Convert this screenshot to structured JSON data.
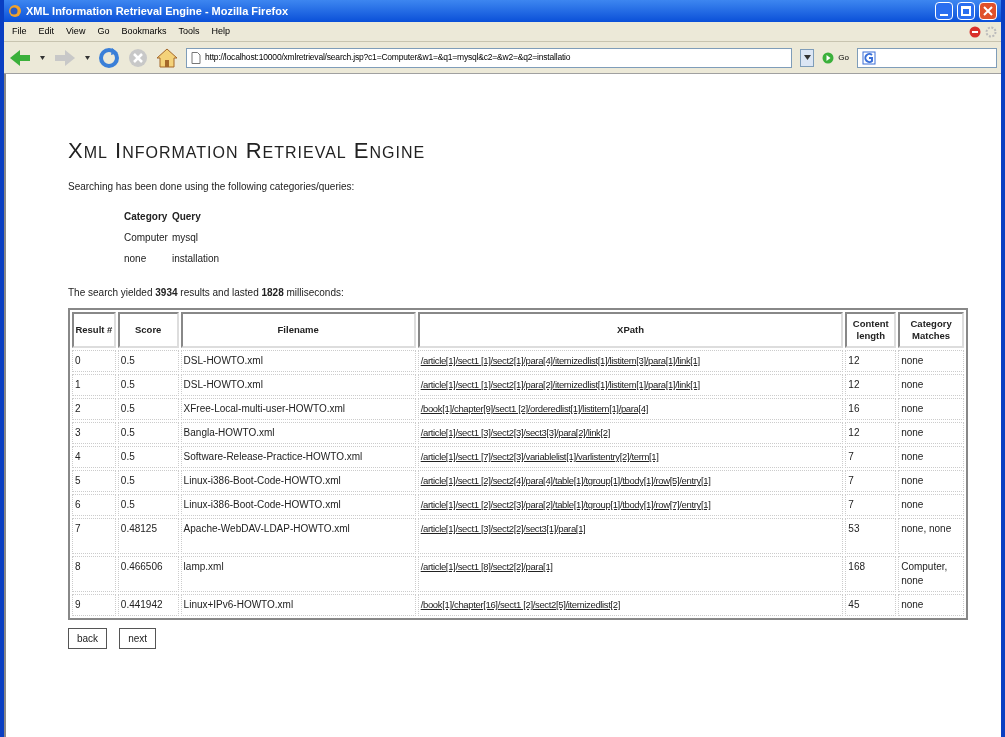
{
  "window": {
    "title": "XML Information Retrieval Engine - Mozilla Firefox"
  },
  "menu": [
    "File",
    "Edit",
    "View",
    "Go",
    "Bookmarks",
    "Tools",
    "Help"
  ],
  "address": {
    "value": "http://localhost:10000/xmlretrieval/search.jsp?c1=Computer&w1=&q1=mysql&c2=&w2=&q2=installatio"
  },
  "go_label": "Go",
  "page": {
    "heading": "XML INFORMATION RETRIEVAL ENGINE",
    "intro": "Searching has been done using the following categories/queries:",
    "queries": {
      "columns": [
        "Category",
        "Query"
      ],
      "rows": [
        [
          "Computer",
          "mysql"
        ],
        [
          "none",
          "installation"
        ]
      ]
    },
    "summary": "The search yielded **3934** results and lasted **1828** milliseconds:",
    "table": {
      "columns": [
        "Result #",
        "Score",
        "Filename",
        "XPath",
        "Content length",
        "Category Matches"
      ],
      "rows": [
        {
          "result": "0",
          "score": "0.5",
          "filename": "DSL-HOWTO.xml",
          "xpath": "/article[1]/sect1 [1]/sect2[1]/para[4]/itemizedlist[1]/listitem[3]/para[1]/link[1]",
          "length": "12",
          "matches": "none"
        },
        {
          "result": "1",
          "score": "0.5",
          "filename": "DSL-HOWTO.xml",
          "xpath": "/article[1]/sect1 [1]/sect2[1]/para[2]/itemizedlist[1]/listitem[1]/para[1]/link[1]",
          "length": "12",
          "matches": "none"
        },
        {
          "result": "2",
          "score": "0.5",
          "filename": "XFree-Local-multi-user-HOWTO.xml",
          "xpath": "/book[1]/chapter[9]/sect1 [2]/orderedlist[1]/listitem[1]/para[4]",
          "length": "16",
          "matches": "none"
        },
        {
          "result": "3",
          "score": "0.5",
          "filename": "Bangla-HOWTO.xml",
          "xpath": "/article[1]/sect1 [3]/sect2[3]/sect3[3]/para[2]/link[2]",
          "length": "12",
          "matches": "none"
        },
        {
          "result": "4",
          "score": "0.5",
          "filename": "Software-Release-Practice-HOWTO.xml",
          "xpath": "/article[1]/sect1 [7]/sect2[3]/variablelist[1]/varlistentry[2]/term[1]",
          "length": "7",
          "matches": "none"
        },
        {
          "result": "5",
          "score": "0.5",
          "filename": "Linux-i386-Boot-Code-HOWTO.xml",
          "xpath": "/article[1]/sect1 [2]/sect2[4]/para[4]/table[1]/tgroup[1]/tbody[1]/row[5]/entry[1]",
          "length": "7",
          "matches": "none"
        },
        {
          "result": "6",
          "score": "0.5",
          "filename": "Linux-i386-Boot-Code-HOWTO.xml",
          "xpath": "/article[1]/sect1 [2]/sect2[3]/para[2]/table[1]/tgroup[1]/tbody[1]/row[7]/entry[1]",
          "length": "7",
          "matches": "none"
        },
        {
          "result": "7",
          "score": "0.48125",
          "filename": "Apache-WebDAV-LDAP-HOWTO.xml",
          "xpath": "/article[1]/sect1 [3]/sect2[2]/sect3[1]/para[1]",
          "length": "53",
          "matches": "none, none"
        },
        {
          "result": "8",
          "score": "0.466506",
          "filename": "lamp.xml",
          "xpath": "/article[1]/sect1 [8]/sect2[2]/para[1]",
          "length": "168",
          "matches": "Computer, none"
        },
        {
          "result": "9",
          "score": "0.441942",
          "filename": "Linux+IPv6-HOWTO.xml",
          "xpath": "/book[1]/chapter[16]/sect1 [2]/sect2[5]/itemizedlist[2]",
          "length": "45",
          "matches": "none"
        }
      ]
    },
    "buttons": [
      "back",
      "next"
    ]
  }
}
